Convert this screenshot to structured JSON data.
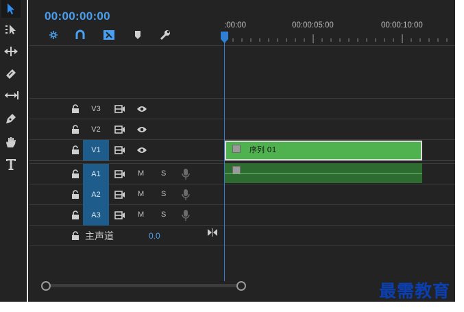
{
  "timecode": "00:00:00:00",
  "ruler": {
    "labels": [
      ":00:00",
      "00:00:05:00",
      "00:00:10:00"
    ]
  },
  "header_icons": [
    "snap-icon",
    "linked-selection-icon",
    "marker-icon",
    "add-marker-icon",
    "wrench-icon"
  ],
  "tools": [
    "selection-tool",
    "track-select-forward-tool",
    "ripple-edit-tool",
    "razor-tool",
    "slip-tool",
    "pen-tool",
    "hand-tool",
    "type-tool"
  ],
  "video_tracks": [
    {
      "name": "V3",
      "active": false
    },
    {
      "name": "V2",
      "active": false
    },
    {
      "name": "V1",
      "active": true
    }
  ],
  "audio_tracks": [
    {
      "name": "A1",
      "mute": "M",
      "solo": "S"
    },
    {
      "name": "A2",
      "mute": "M",
      "solo": "S"
    },
    {
      "name": "A3",
      "mute": "M",
      "solo": "S"
    }
  ],
  "master": {
    "label": "主声道",
    "value": "0.0"
  },
  "clips": {
    "v1_label": "序列 01"
  },
  "watermark": "最需教育",
  "colors": {
    "timecode": "#4aa0f0",
    "playhead": "#2f7fd4",
    "track_active": "#1e5c8c",
    "clip_video": "#4fb24f",
    "clip_audio": "#2e6b30"
  }
}
